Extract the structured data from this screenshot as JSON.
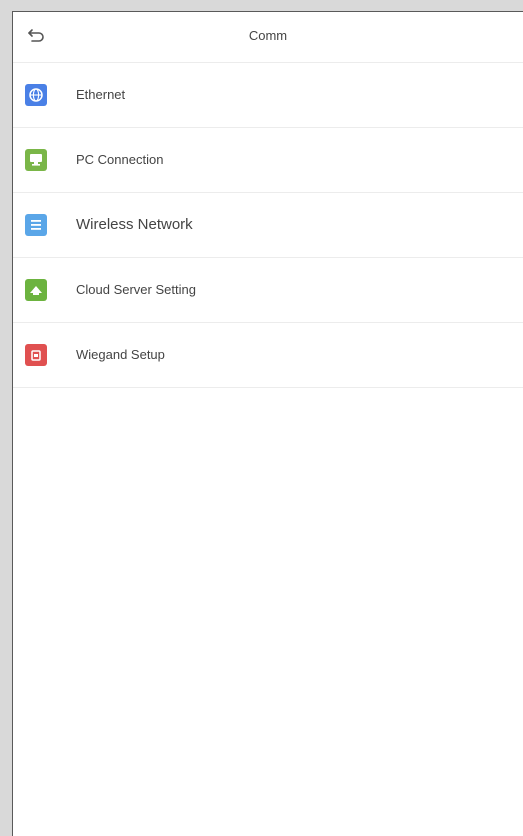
{
  "header": {
    "title": "Comm"
  },
  "menu": {
    "items": [
      {
        "label": "Ethernet",
        "icon": "ethernet-icon",
        "color": "#4a80e6"
      },
      {
        "label": "PC Connection",
        "icon": "pc-connection-icon",
        "color": "#7ab648"
      },
      {
        "label": "Wireless Network",
        "icon": "wireless-network-icon",
        "color": "#5aa6e8"
      },
      {
        "label": "Cloud Server Setting",
        "icon": "cloud-server-icon",
        "color": "#6cb33f"
      },
      {
        "label": "Wiegand Setup",
        "icon": "wiegand-icon",
        "color": "#e05050"
      }
    ]
  }
}
